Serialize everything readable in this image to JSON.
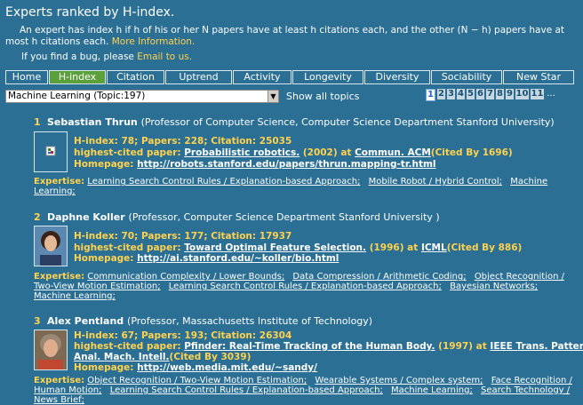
{
  "header": {
    "title": "Experts ranked by H-index.",
    "desc_text": "An expert has index h if h of his or her N papers have at least h citations each, and the other (N − h) papers have at most h citations each.",
    "more_info": "More Information.",
    "bug_text": "If you find a bug, please",
    "email_link": "Email to us."
  },
  "tabs": [
    "Home",
    "H-index",
    "Citation",
    "Uptrend",
    "Activity",
    "Longevity",
    "Diversity",
    "Sociability",
    "New Star"
  ],
  "active_tab": "H-index",
  "topic_select": {
    "value": "Machine Learning (Topic:197)"
  },
  "show_all": "Show all topics",
  "pages": [
    "1",
    "2",
    "3",
    "4",
    "5",
    "6",
    "7",
    "8",
    "9",
    "10",
    "11",
    "..."
  ],
  "current_page": "1",
  "experts": [
    {
      "rank": "1",
      "name": "Sebastian Thrun",
      "affiliation": "(Professor of Computer Science, Computer Science Department Stanford University)",
      "hindex_label": "H-index:",
      "hindex": "78",
      "papers_label": "Papers:",
      "papers": "228",
      "citation_label": "Citation:",
      "citation": "25035",
      "paper_label": "highest-cited paper:",
      "paper_title": "Probabilistic robotics.",
      "paper_year": "(2002) at",
      "venue": "Commun. ACM",
      "cited_by": "(Cited By 1696)",
      "homepage_label": "Homepage:",
      "homepage": "http://robots.stanford.edu/papers/thrun.mapping-tr.html",
      "expertise_label": "Expertise:",
      "expertise": [
        "Learning Search Control Rules / Explanation-based Approach;",
        "Mobile Robot / Hybrid Control;",
        "Machine Learning;"
      ]
    },
    {
      "rank": "2",
      "name": "Daphne Koller",
      "affiliation": "(Professor, Computer Science Department Stanford University )",
      "hindex_label": "H-index:",
      "hindex": "70",
      "papers_label": "Papers:",
      "papers": "177",
      "citation_label": "Citation:",
      "citation": "17937",
      "paper_label": "highest-cited paper:",
      "paper_title": "Toward Optimal Feature Selection.",
      "paper_year": "(1996) at",
      "venue": "ICML",
      "cited_by": "(Cited By 886)",
      "homepage_label": "Homepage:",
      "homepage": "http://ai.stanford.edu/~koller/bio.html",
      "expertise_label": "Expertise:",
      "expertise": [
        "Communication Complexity / Lower Bounds;",
        "Data Compression / Arithmetic Coding;",
        "Object Recognition / Two-View Motion Estimation;",
        "Learning Search Control Rules / Explanation-based Approach;",
        "Bayesian Networks;",
        "Machine Learning;"
      ]
    },
    {
      "rank": "3",
      "name": "Alex Pentland",
      "affiliation": "(Professor, Massachusetts Institute of Technology)",
      "hindex_label": "H-index:",
      "hindex": "67",
      "papers_label": "Papers:",
      "papers": "193",
      "citation_label": "Citation:",
      "citation": "26304",
      "paper_label": "highest-cited paper:",
      "paper_title": "Pfinder: Real-Time Tracking of the Human Body.",
      "paper_year": "(1997) at",
      "venue": "IEEE Trans. Pattern",
      "venue2": "Anal. Mach. Intell.",
      "cited_by": "(Cited By 3039)",
      "homepage_label": "Homepage:",
      "homepage": "http://web.media.mit.edu/~sandy/",
      "expertise_label": "Expertise:",
      "expertise": [
        "Object Recognition / Two-View Motion Estimation;",
        "Wearable Systems / Complex system;",
        "Face Recognition / Human Motion;",
        "Learning Search Control Rules / Explanation-based Approach;",
        "Machine Learning;",
        "Search Technology / News Brief;"
      ]
    }
  ]
}
